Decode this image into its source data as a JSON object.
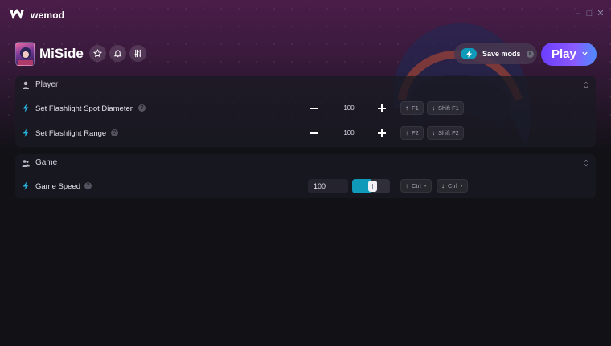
{
  "app": {
    "brand": "wemod"
  },
  "window_controls": {
    "minimize": "–",
    "maximize": "□",
    "close": "✕"
  },
  "game": {
    "title": "MiSide",
    "header_buttons": [
      {
        "name": "favorite",
        "icon": "star-icon"
      },
      {
        "name": "notifications",
        "icon": "bell-icon"
      },
      {
        "name": "settings",
        "icon": "sliders-icon"
      }
    ],
    "save_mods": {
      "label": "Save mods",
      "enabled": true,
      "info": "i"
    },
    "play": {
      "label": "Play"
    }
  },
  "sections": [
    {
      "title": "Player",
      "icon": "person-icon",
      "mods": [
        {
          "label": "Set Flashlight Spot Diameter",
          "help": "?",
          "value": "100",
          "hotkeys": [
            "F1",
            "Shift F1"
          ]
        },
        {
          "label": "Set Flashlight Range",
          "help": "?",
          "value": "100",
          "hotkeys": [
            "F2",
            "Shift F2"
          ]
        }
      ]
    },
    {
      "title": "Game",
      "icon": "people-icon",
      "mods": [
        {
          "label": "Game Speed",
          "help": "?",
          "value": "100",
          "slider_fraction": 0.5,
          "hotkeys": [
            "Ctrl",
            "Ctrl"
          ]
        }
      ]
    }
  ],
  "colors": {
    "accent": "#0e9ab8",
    "play_start": "#6c3dff",
    "play_end": "#4f8bff",
    "bolt": "#28b4e0"
  }
}
